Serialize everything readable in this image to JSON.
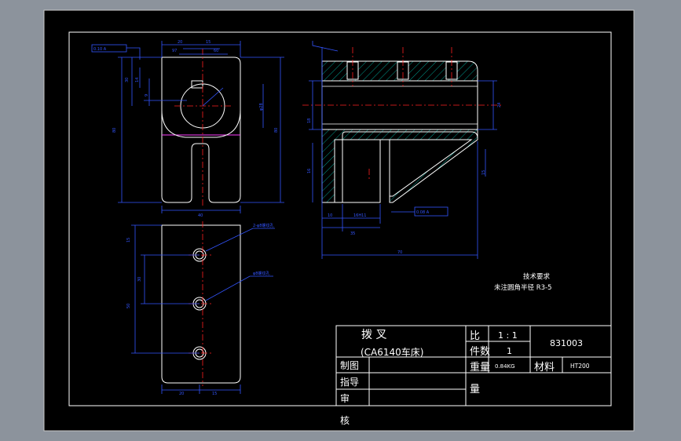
{
  "drawing": {
    "tech_req_title": "技术要求",
    "tech_req_text": "未注圆角半径 R3-5"
  },
  "title_block": {
    "part_name": "拨 叉",
    "subtitle": "(CA6140车床)",
    "drawn_label": "制图",
    "guide_label": "指导",
    "review_label_top": "审",
    "review_label_bottom": "核",
    "ratio_label": "比",
    "ratio_value": "1 : 1",
    "qty_label": "件数",
    "qty_value": "1",
    "weight_label": "重量",
    "weight_value": "0.84KG",
    "material_label": "材料",
    "material_value": "HT200",
    "drawing_no": "831003",
    "sheet_label": "量"
  },
  "dimensions": {
    "top_left_frame": "0.10 A",
    "d20": "20",
    "d15": "15",
    "d97": "97",
    "d60": "60",
    "d80": "80",
    "d30": "30",
    "d14": "14",
    "d9": "9",
    "d10": "10",
    "d50": "50",
    "d40": "40",
    "d16": "16",
    "phi28": "φ28",
    "d18": "18",
    "d24": "24",
    "d16h": "16H11",
    "d35": "35",
    "d70": "70",
    "frame_b": "0.08 A",
    "hole_a": "2-φ8螺纹孔",
    "hole_b": "φ8螺纹孔"
  },
  "colors": {
    "outer_bg": "#8c939c",
    "sheet_bg": "#000000",
    "line": "#ffffff",
    "dim": "#3355ff",
    "center": "#ff2020",
    "hatch": "#00c0b0",
    "magenta": "#ff40ff"
  }
}
